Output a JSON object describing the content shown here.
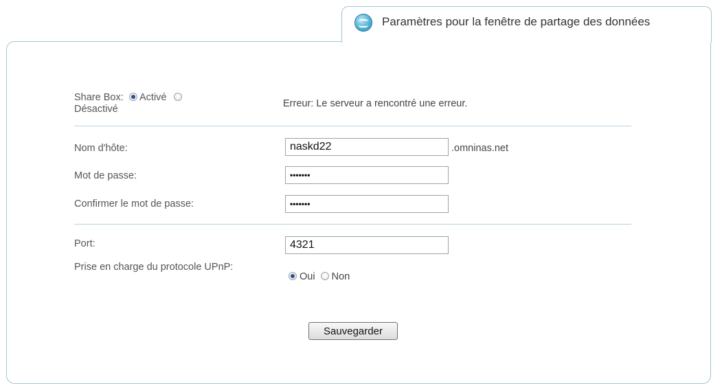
{
  "tab": {
    "title": "Paramètres pour la fenêtre de partage des données",
    "icon": "share-globe-icon"
  },
  "sharebox": {
    "label": "Share Box:",
    "option_on": "Activé",
    "option_off": "Désactivé",
    "selected": "Activé",
    "error_message": "Erreur: Le serveur a rencontré une erreur."
  },
  "hostname": {
    "label": "Nom d'hôte:",
    "value": "naskd22",
    "suffix": ".omninas.net"
  },
  "password": {
    "label": "Mot de passe:",
    "masked": "•••••••"
  },
  "confirm_password": {
    "label": "Confirmer le mot de passe:",
    "masked": "•••••••"
  },
  "port": {
    "label": "Port:",
    "value": "4321"
  },
  "upnp": {
    "label": "Prise en charge du protocole UPnP:",
    "option_yes": "Oui",
    "option_no": "Non",
    "selected": "Oui"
  },
  "save_button": {
    "label": "Sauvegarder"
  },
  "colors": {
    "border_accent": "#9fc6d2",
    "divider": "#b8d4dd",
    "radio_dot": "#2d4f8a"
  }
}
